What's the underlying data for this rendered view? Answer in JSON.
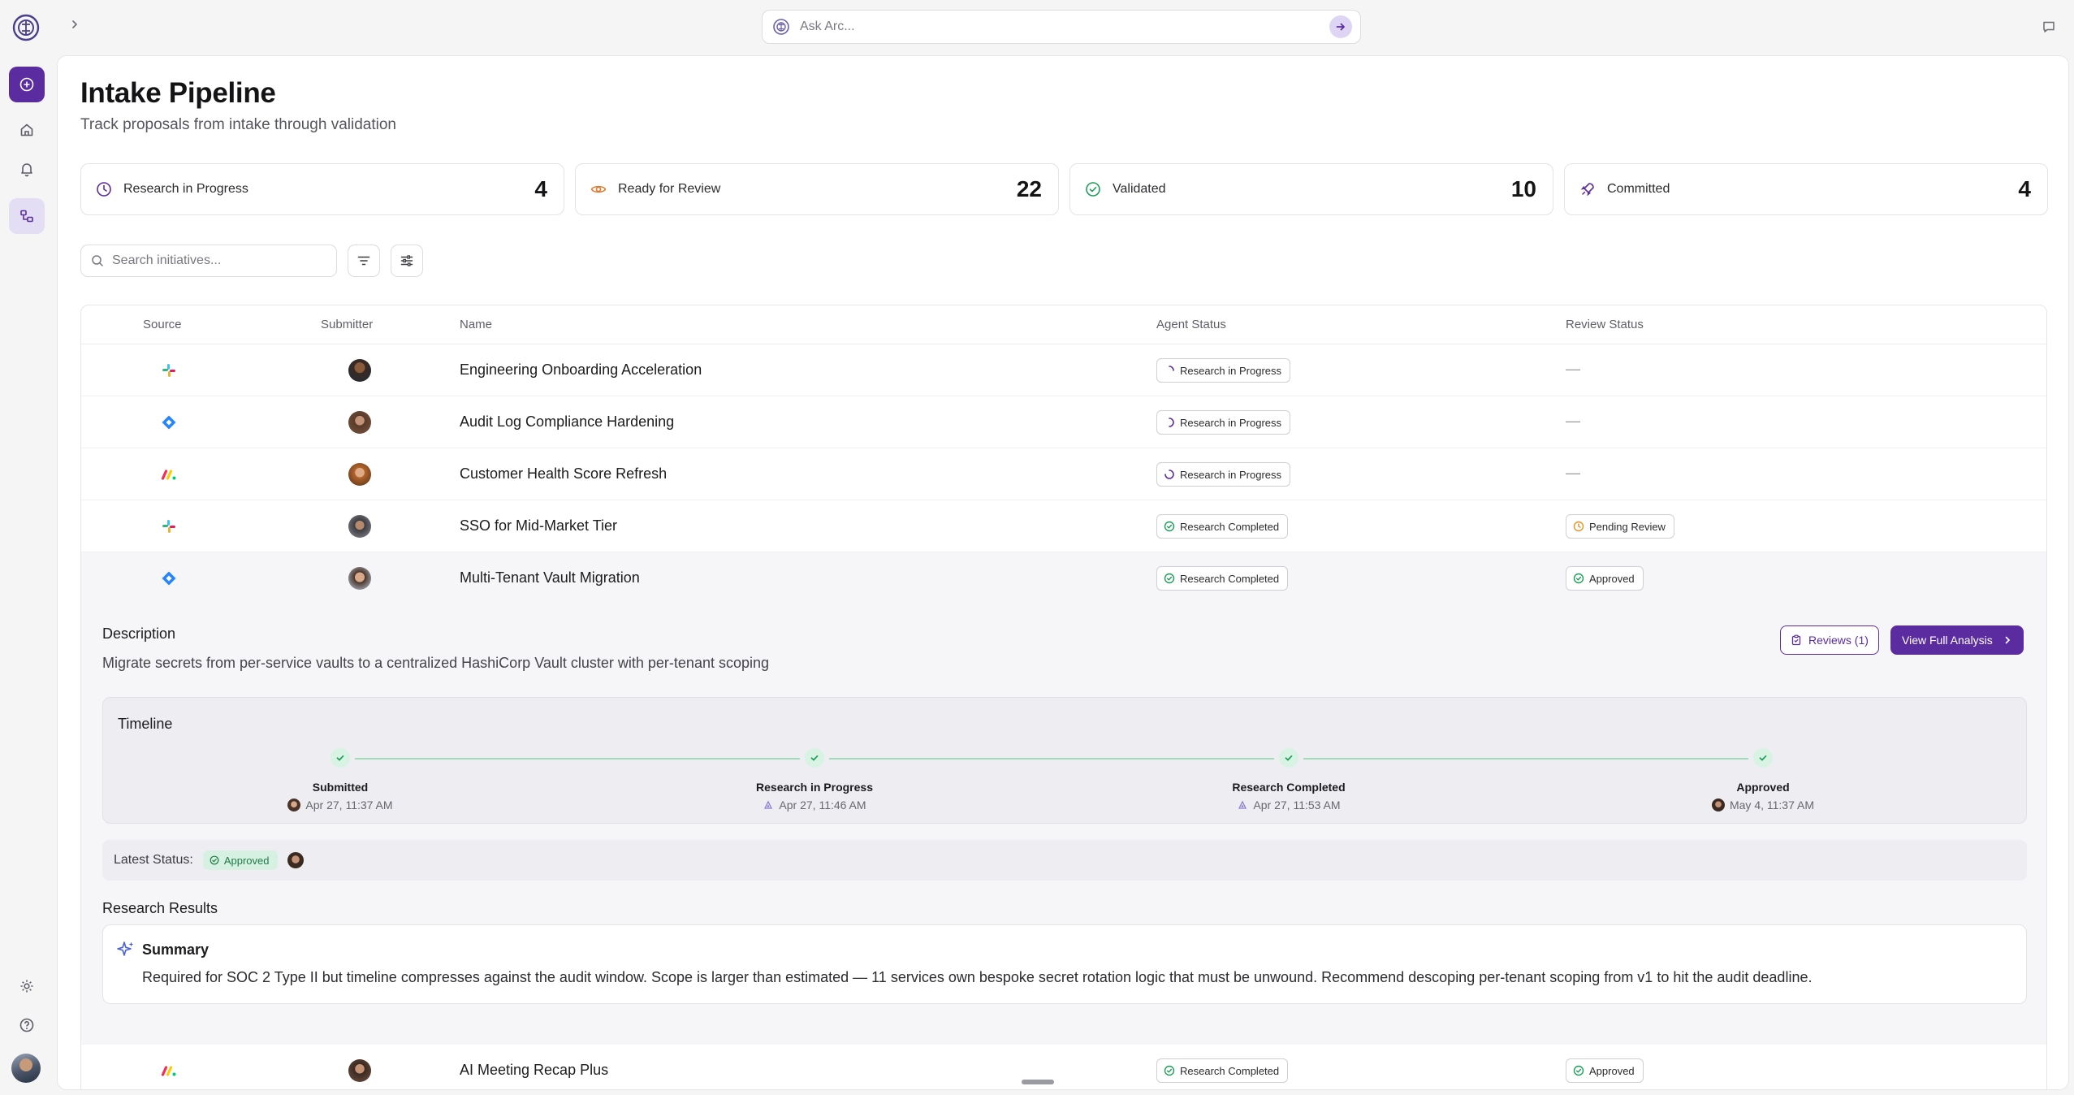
{
  "app": {
    "ask_placeholder": "Ask Arc...",
    "accent_color": "#5b2ca0"
  },
  "rail": {
    "items": [
      {
        "icon": "plus-circle-icon",
        "name": "new-button"
      },
      {
        "icon": "home-icon",
        "name": "home"
      },
      {
        "icon": "bell-icon",
        "name": "notifications"
      },
      {
        "icon": "pipeline-icon",
        "name": "pipeline"
      },
      {
        "icon": "gear-icon",
        "name": "settings"
      },
      {
        "icon": "help-icon",
        "name": "help"
      }
    ]
  },
  "page": {
    "title": "Intake Pipeline",
    "subtitle": "Track proposals from intake through validation"
  },
  "stats": [
    {
      "label": "Research in Progress",
      "value": "4",
      "icon": "clock-icon",
      "color": "#5b2ca0"
    },
    {
      "label": "Ready for Review",
      "value": "22",
      "icon": "eye-icon",
      "color": "#e07a2e"
    },
    {
      "label": "Validated",
      "value": "10",
      "icon": "check-circle-icon",
      "color": "#1f9d5a"
    },
    {
      "label": "Committed",
      "value": "4",
      "icon": "rocket-icon",
      "color": "#5b2ca0"
    }
  ],
  "search": {
    "placeholder": "Search initiatives..."
  },
  "table": {
    "columns": [
      "Source",
      "Submitter",
      "Name",
      "Agent Status",
      "Review Status"
    ],
    "rows": [
      {
        "source": "slack",
        "name": "Engineering Onboarding Acceleration",
        "agent_status": "Research in Progress",
        "review_status": "—"
      },
      {
        "source": "jira",
        "name": "Audit Log Compliance Hardening",
        "agent_status": "Research in Progress",
        "review_status": "—"
      },
      {
        "source": "monday",
        "name": "Customer Health Score Refresh",
        "agent_status": "Research in Progress",
        "review_status": "—"
      },
      {
        "source": "slack",
        "name": "SSO for Mid-Market Tier",
        "agent_status": "Research Completed",
        "review_status": "Pending Review"
      },
      {
        "source": "jira",
        "name": "Multi-Tenant Vault Migration",
        "agent_status": "Research Completed",
        "review_status": "Approved"
      },
      {
        "source": "monday",
        "name": "AI Meeting Recap Plus",
        "agent_status": "Research Completed",
        "review_status": "Approved"
      }
    ]
  },
  "detail": {
    "description_title": "Description",
    "description": "Migrate secrets from per-service vaults to a centralized HashiCorp Vault cluster with per-tenant scoping",
    "reviews_label": "Reviews (1)",
    "analysis_label": "View Full Analysis",
    "timeline_title": "Timeline",
    "timeline": [
      {
        "label": "Submitted",
        "time": "Apr 27, 11:37 AM"
      },
      {
        "label": "Research in Progress",
        "time": "Apr 27, 11:46 AM"
      },
      {
        "label": "Research Completed",
        "time": "Apr 27, 11:53 AM"
      },
      {
        "label": "Approved",
        "time": "May 4, 11:37 AM"
      }
    ],
    "latest_label": "Latest Status:",
    "latest_value": "Approved",
    "results_title": "Research Results",
    "summary_title": "Summary",
    "summary_text": "Required for SOC 2 Type II but timeline compresses against the audit window. Scope is larger than estimated — 11 services own bespoke secret rotation logic that must be unwound. Recommend descoping per-tenant scoping from v1 to hit the audit deadline."
  }
}
